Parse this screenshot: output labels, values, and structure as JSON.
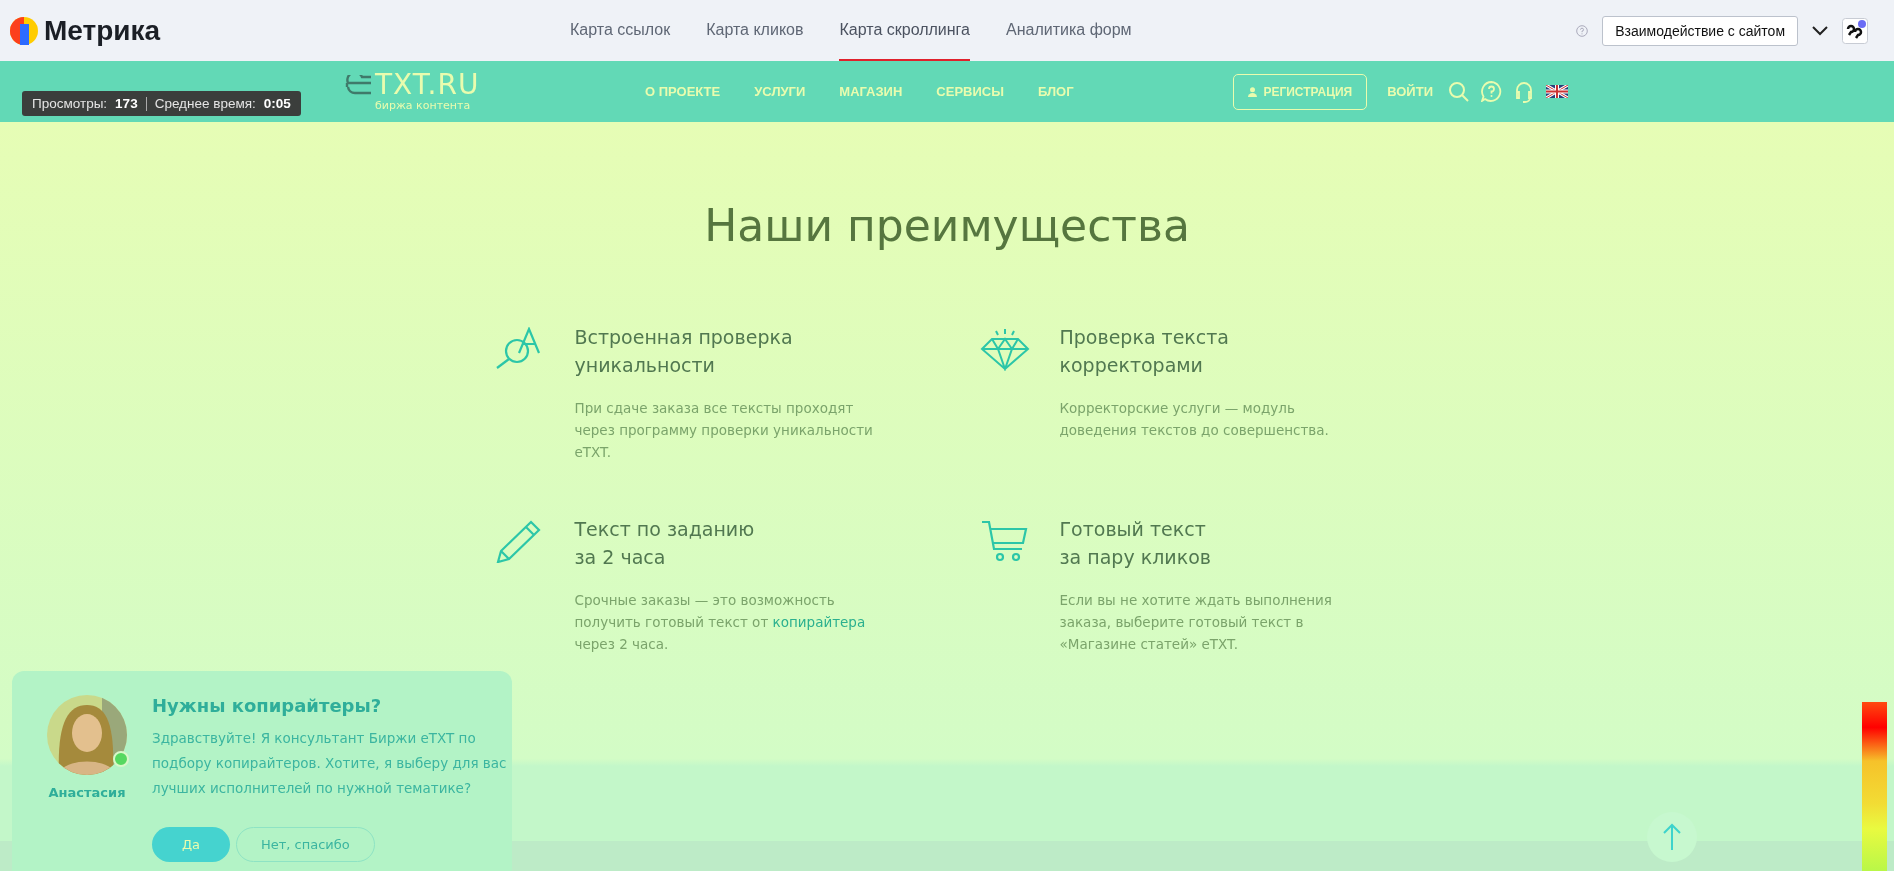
{
  "metrica": {
    "logo": "Метрика",
    "tabs": [
      {
        "label": "Карта ссылок",
        "selected": false
      },
      {
        "label": "Карта кликов",
        "selected": false
      },
      {
        "label": "Карта скроллинга",
        "selected": true
      },
      {
        "label": "Аналитика форм",
        "selected": false
      }
    ],
    "mode_button": "Взаимодействие с сайтом"
  },
  "stats": {
    "views_label": "Просмотры:",
    "views": "173",
    "time_label": "Среднее время:",
    "time": "0:05"
  },
  "site": {
    "logo": "TXT.RU",
    "tagline": "биржа контента",
    "nav": [
      "О ПРОЕКТЕ",
      "УСЛУГИ",
      "МАГАЗИН",
      "СЕРВИСЫ",
      "БЛОГ"
    ],
    "register": "РЕГИСТРАЦИЯ",
    "login": "ВОЙТИ"
  },
  "section_title": "Наши преимущества",
  "features": [
    {
      "kind": "magnifier",
      "title": "Встроенная проверка уникальности",
      "text": "При сдаче заказа все тексты проходят через программу проверки уникальности eTXT."
    },
    {
      "kind": "diamond",
      "title": "Проверка текста корректорами",
      "text": "Корректорские услуги — модуль доведения текстов до совершенства."
    },
    {
      "kind": "pencil",
      "title": "Текст по заданию\nза 2 часа",
      "text": "Срочные заказы — это возможность получить готовый текст от",
      "link": "копирайтера",
      "text_after": "через 2 часа."
    },
    {
      "kind": "cart",
      "title": "Готовый текст\nза пару кликов",
      "text": "Если вы не хотите ждать выполнения заказа, выберите готовый текст в «Магазине статей» eTXT."
    }
  ],
  "chat": {
    "title": "Нужны копирайтеры?",
    "text": "Здравствуйте! Я консультант Биржи eTXT по подбору копирайтеров. Хотите, я выберу для вас лучших исполнителей по нужной тематике?",
    "name": "Анастасия",
    "online": true,
    "buttons": [
      {
        "label": "Да",
        "kind": "primary"
      },
      {
        "label": "Нет, спасибо",
        "kind": "secondary"
      }
    ]
  }
}
